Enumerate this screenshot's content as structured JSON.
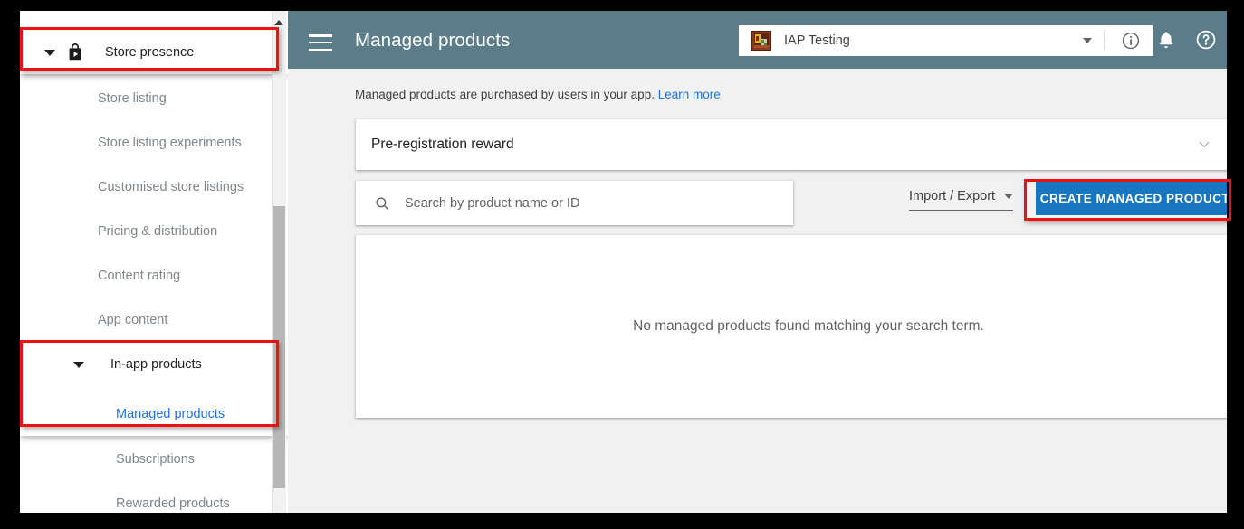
{
  "sidebar": {
    "groups": [
      {
        "label": "Store presence",
        "icon": "play-store-bag-icon",
        "expanded": true,
        "highlighted": true,
        "items": [
          {
            "label": "Store listing",
            "selected": false
          },
          {
            "label": "Store listing experiments",
            "selected": false
          },
          {
            "label": "Customised store listings",
            "selected": false
          },
          {
            "label": "Pricing & distribution",
            "selected": false
          },
          {
            "label": "Content rating",
            "selected": false
          },
          {
            "label": "App content",
            "selected": false
          }
        ]
      },
      {
        "label": "In-app products",
        "icon": null,
        "expanded": true,
        "highlighted": true,
        "items": [
          {
            "label": "Managed products",
            "selected": true
          },
          {
            "label": "Subscriptions",
            "selected": false
          },
          {
            "label": "Rewarded products",
            "selected": false
          }
        ]
      }
    ],
    "scrollbar": {
      "up_arrow": "scroll-up-arrow-icon"
    }
  },
  "header": {
    "menu_icon": "hamburger-menu-icon",
    "title": "Managed products",
    "app_selector": {
      "app_icon": "app-thumbnail-icon",
      "app_name": "IAP Testing",
      "caret": "chevron-down-icon",
      "info_icon": "info-circle-icon"
    },
    "notifications_icon": "bell-icon",
    "help_icon": "help-circle-icon",
    "bar_color": "#5b7c89"
  },
  "content": {
    "subtitle": "Managed products are purchased by users in your app.",
    "subtitle_link": "Learn more",
    "prereg": {
      "label": "Pre-registration reward",
      "expand_icon": "chevron-down-icon"
    },
    "search": {
      "placeholder": "Search by product name or ID",
      "value": "",
      "icon": "search-icon"
    },
    "import_export": {
      "label": "Import / Export",
      "caret": "chevron-down-icon"
    },
    "create_button": {
      "label": "CREATE MANAGED PRODUCT",
      "color": "#1875bf",
      "highlighted": true
    },
    "empty_state": "No managed products found matching your search term."
  },
  "annotations": {
    "color": "#ee1111",
    "boxes": [
      {
        "target": "store-presence-nav-group"
      },
      {
        "target": "in-app-products-nav-group"
      },
      {
        "target": "create-managed-product-button"
      }
    ]
  }
}
